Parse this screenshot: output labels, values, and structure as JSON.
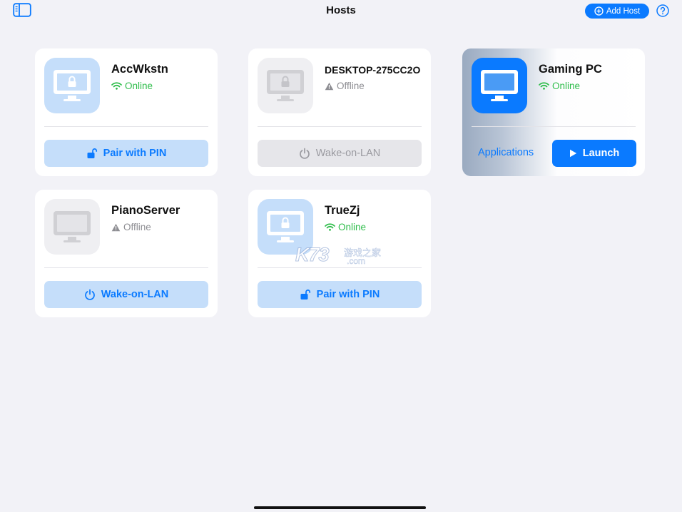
{
  "header": {
    "title": "Hosts",
    "add_host_label": "Add Host",
    "sidebar_icon": "sidebar-icon",
    "help_icon": "question-circle-icon"
  },
  "hosts": [
    {
      "name": "AccWkstn",
      "status": "Online",
      "icon": "locked-monitor-icon",
      "action": "Pair with PIN",
      "action_icon": "unlock-icon"
    },
    {
      "name": "DESKTOP-275CC2O",
      "status": "Offline",
      "icon": "locked-monitor-icon",
      "action": "Wake-on-LAN",
      "action_icon": "power-icon"
    },
    {
      "name": "Gaming PC",
      "status": "Online",
      "icon": "monitor-icon",
      "secondary_action": "Applications",
      "action": "Launch",
      "action_icon": "play-icon"
    },
    {
      "name": "PianoServer",
      "status": "Offline",
      "icon": "monitor-icon",
      "action": "Wake-on-LAN",
      "action_icon": "power-icon"
    },
    {
      "name": "TrueZj",
      "status": "Online",
      "icon": "locked-monitor-icon",
      "action": "Pair with PIN",
      "action_icon": "unlock-icon"
    }
  ],
  "watermark": {
    "brand": "K73",
    "cn": "游戏之家",
    "domain": ".com"
  },
  "colors": {
    "accent": "#0a7aff",
    "online": "#2fbd4b",
    "offline": "#8e8e93",
    "tile_light": "#c5defa",
    "background": "#f2f2f7"
  }
}
